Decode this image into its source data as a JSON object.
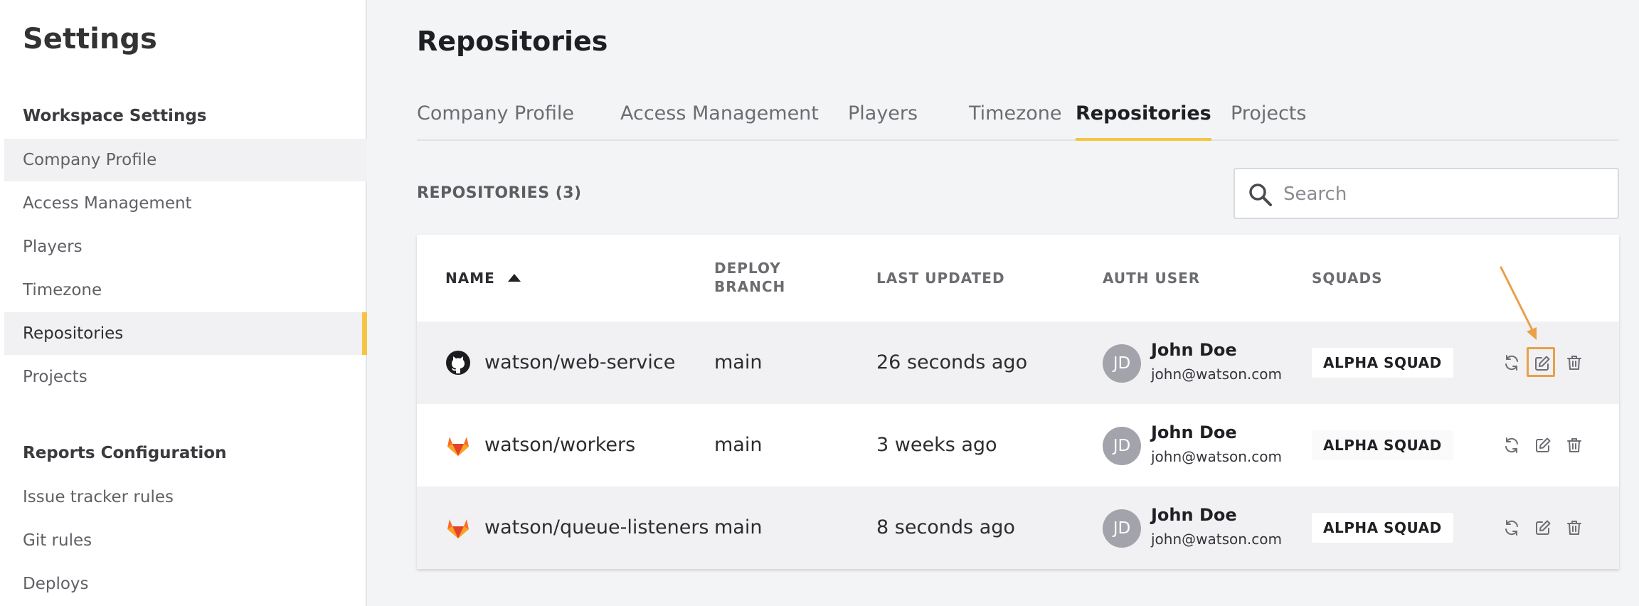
{
  "sidebar": {
    "title": "Settings",
    "sections": [
      {
        "title": "Workspace Settings",
        "items": [
          {
            "label": "Company Profile"
          },
          {
            "label": "Access Management"
          },
          {
            "label": "Players"
          },
          {
            "label": "Timezone"
          },
          {
            "label": "Repositories"
          },
          {
            "label": "Projects"
          }
        ]
      },
      {
        "title": "Reports Configuration",
        "items": [
          {
            "label": "Issue tracker rules"
          },
          {
            "label": "Git rules"
          },
          {
            "label": "Deploys"
          }
        ]
      }
    ],
    "active_item": "Repositories",
    "accent_color": "#f4c542"
  },
  "main": {
    "title": "Repositories",
    "tabs": [
      {
        "label": "Company Profile"
      },
      {
        "label": "Access Management"
      },
      {
        "label": "Players"
      },
      {
        "label": "Timezone"
      },
      {
        "label": "Repositories"
      },
      {
        "label": "Projects"
      }
    ],
    "active_tab": "Repositories",
    "count_label": "REPOSITORIES (3)",
    "search": {
      "placeholder": "Search",
      "value": "",
      "icon": "search-icon"
    }
  },
  "table": {
    "columns": {
      "name": "NAME",
      "deploy_branch_line1": "DEPLOY",
      "deploy_branch_line2": "BRANCH",
      "last_updated": "LAST UPDATED",
      "auth_user": "AUTH USER",
      "squads": "SQUADS"
    },
    "sort": {
      "column": "NAME",
      "direction": "ascending"
    },
    "rows": [
      {
        "provider_icon": "github-icon",
        "name": "watson/web-service",
        "branch": "main",
        "updated": "26 seconds ago",
        "user_initials": "JD",
        "user_name": "John Doe",
        "user_email": "john@watson.com",
        "squad": "ALPHA SQUAD"
      },
      {
        "provider_icon": "gitlab-icon",
        "name": "watson/workers",
        "branch": "main",
        "updated": "3 weeks ago",
        "user_initials": "JD",
        "user_name": "John Doe",
        "user_email": "john@watson.com",
        "squad": "ALPHA SQUAD"
      },
      {
        "provider_icon": "gitlab-icon",
        "name": "watson/queue-listeners",
        "branch": "main",
        "updated": "8 seconds ago",
        "user_initials": "JD",
        "user_name": "John Doe",
        "user_email": "john@watson.com",
        "squad": "ALPHA SQUAD"
      }
    ],
    "row_actions": [
      "refresh-icon",
      "edit-icon",
      "delete-icon"
    ],
    "highlighted_action": "edit-icon on first row",
    "highlight_color": "#e9a048"
  }
}
